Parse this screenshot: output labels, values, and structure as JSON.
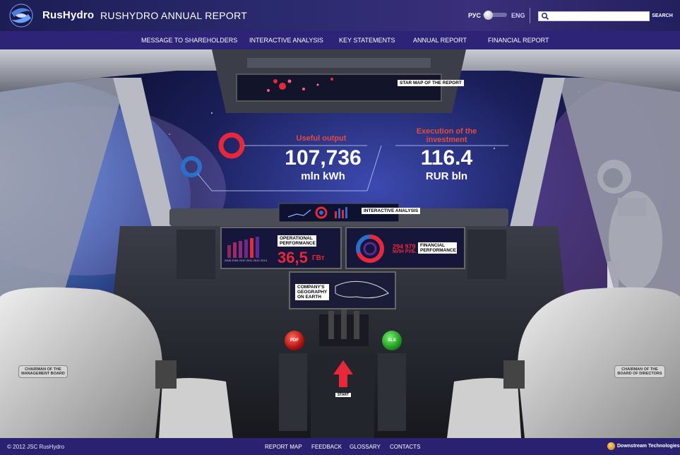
{
  "header": {
    "brand": "RusHydro",
    "title": "RUSHYDRO ANNUAL REPORT",
    "lang_ru": "РУС",
    "lang_en": "ENG",
    "search_placeholder": "",
    "search_button": "SEARCH"
  },
  "nav": {
    "items": [
      "MESSAGE TO SHAREHOLDERS",
      "INTERACTIVE ANALYSIS",
      "KEY STATEMENTS",
      "ANNUAL REPORT",
      "FINANCIAL REPORT"
    ]
  },
  "cockpit": {
    "star_map": "STAR MAP OF THE REPORT",
    "useful_output": {
      "label": "Useful output",
      "value": "107,736",
      "unit": "mln kWh"
    },
    "investment": {
      "label": "Execution of the investment",
      "value": "116.4",
      "unit": "RUR bln"
    },
    "interactive_analysis": "INTERACTIVE ANALYSIS",
    "operational": {
      "label": "OPERATIONAL PERFORMANCE",
      "value": "36,5",
      "unit": "ГВт",
      "years": [
        "2008",
        "2009",
        "2010",
        "2011",
        "2012",
        "2013"
      ]
    },
    "financial": {
      "label": "FINANCIAL PERFORMANCE",
      "value": "294 979",
      "unit": "МЛН РУБ."
    },
    "geography": "COMPANY'S GEOGRAPHY ON EARTH",
    "pdf_button": "PDF",
    "xls_button": "XLS",
    "start_button": "START",
    "chairman_management": "CHAIRMAN OF THE MANAGEMENT BOARD",
    "chairman_directors": "CHAIRMAN OF THE BOARD OF DIRECTORS"
  },
  "footer": {
    "copyright": "© 2012 JSC RusHydro",
    "links": [
      "REPORT MAP",
      "FEEDBACK",
      "GLOSSARY",
      "CONTACTS"
    ],
    "developer": "Downstream Technologies"
  },
  "colors": {
    "header_bg": "#2a2a6e",
    "nav_bg": "#2d2377",
    "accent_red": "#e8283a",
    "accent_blue": "#2b6fc9"
  }
}
